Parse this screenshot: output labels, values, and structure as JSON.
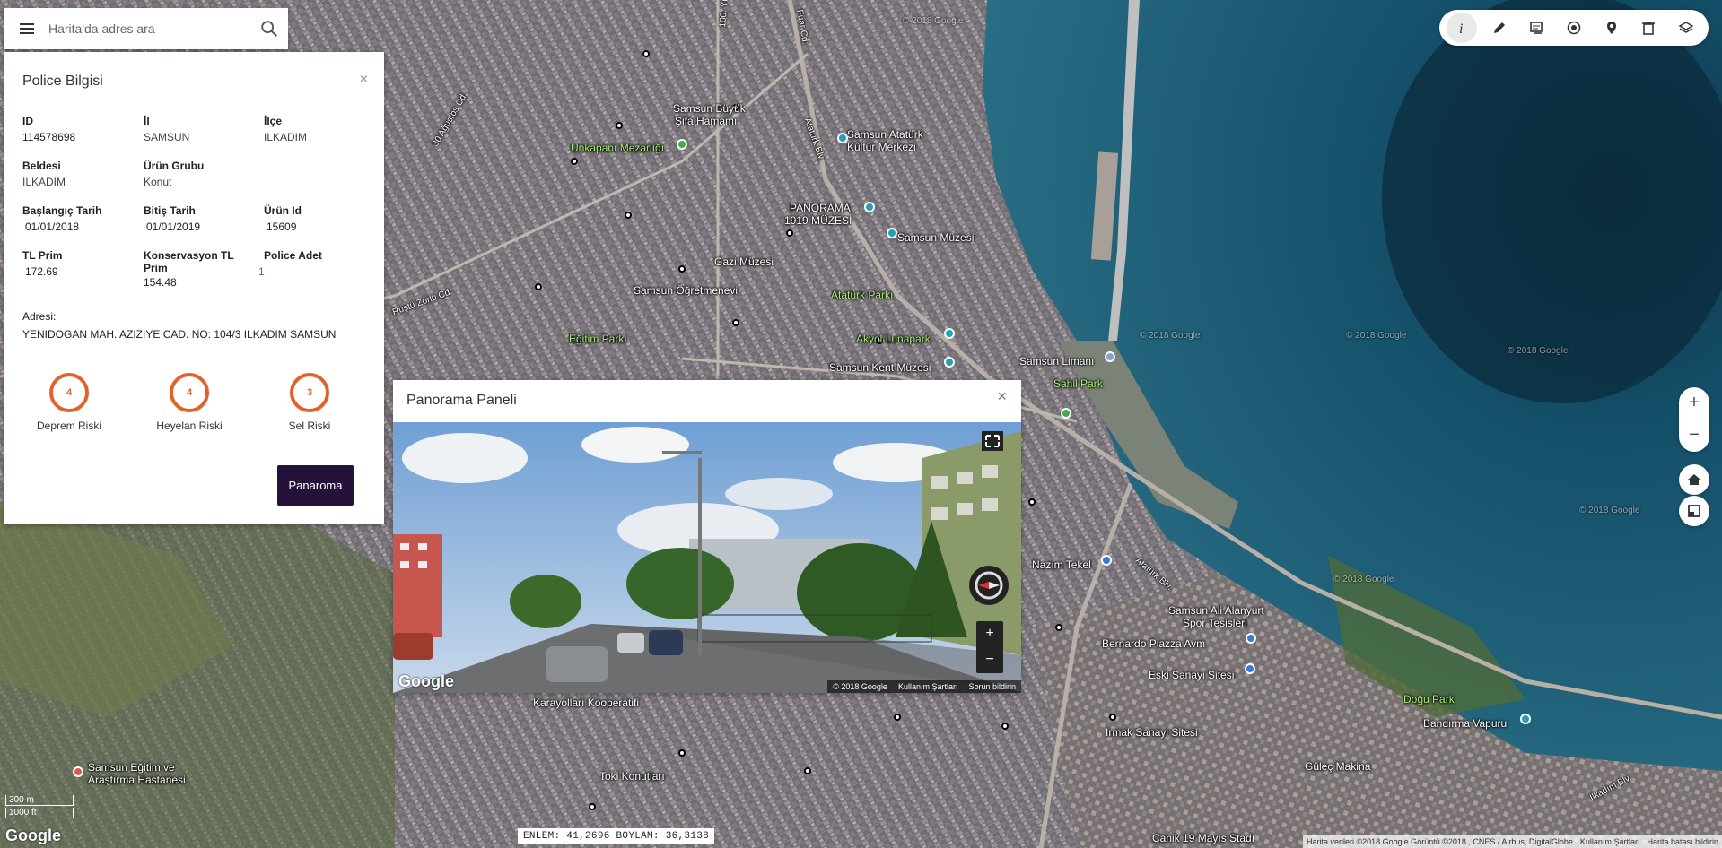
{
  "search": {
    "placeholder": "Harita'da adres ara"
  },
  "police": {
    "title": "Police Bilgisi",
    "close": "×",
    "fields": [
      {
        "label": "ID",
        "value": "114578698"
      },
      {
        "label": "İl",
        "value": "SAMSUN"
      },
      {
        "label": "İlçe",
        "value": "ILKADIM"
      },
      {
        "label": "Beldesi",
        "value": "ILKADIM"
      },
      {
        "label": "Ürün Grubu",
        "value": "Konut"
      },
      {
        "label": "Başlangıç Tarih",
        "value": "01/01/2018"
      },
      {
        "label": "Bitiş Tarih",
        "value": "01/01/2019"
      },
      {
        "label": "Ürün Id",
        "value": "15609"
      },
      {
        "label": "TL Prim",
        "value": "172.69"
      },
      {
        "label": "Konservasyon TL Prim",
        "value": "154.48"
      },
      {
        "label": "Police Adet",
        "value": "1"
      }
    ],
    "address_label": "Adresi:",
    "address": "YENIDOGAN MAH. AZIZIYE CAD. NO: 104/3 ILKADIM SAMSUN",
    "risks": [
      {
        "value": "4",
        "label": "Deprem Riski"
      },
      {
        "value": "4",
        "label": "Heyelan Riski"
      },
      {
        "value": "3",
        "label": "Sel Riski"
      }
    ],
    "panorama_button": "Panaroma",
    "risk_color": "#e2622b",
    "button_color": "#24123b"
  },
  "panorama": {
    "title": "Panorama Paneli",
    "close": "×",
    "zoom_in": "+",
    "zoom_out": "−",
    "google": "Google",
    "footer": [
      "© 2018 Google",
      "Kullanım Şartları",
      "Sorun bildirin"
    ]
  },
  "toolbar": {
    "tools": [
      "info-icon",
      "pencil-icon",
      "layers-card-icon",
      "target-icon",
      "pin-icon",
      "trash-icon",
      "layers-icon"
    ]
  },
  "map_controls": {
    "zoom_in": "+",
    "zoom_out": "−"
  },
  "coords": "ENLEM: 41,2696 BOYLAM: 36,3138",
  "scale": {
    "top": "300 m",
    "bottom": "1000 ft"
  },
  "google_logo": "Google",
  "attribution": [
    "Harita verileri ©2018 Google Görüntü ©2018 , CNES / Airbus, DigitalGlobe",
    "Kullanım Şartları",
    "Harita hatası bildirin"
  ],
  "map_labels": [
    "Samsun Büyük",
    "Şifa Hamamı",
    "Unkapanı Mezarlığı",
    "Samsun Atatürk",
    "Kültür Merkezi",
    "PANORAMA",
    "1919 MÜZESİ",
    "Samsun Müzesi",
    "Gazi Müzesi",
    "Samsun Öğretmenevi",
    "Atatürk Parkı",
    "Eğitim Parkı",
    "Akyol Lunapark",
    "Samsun Kent Müzesi",
    "Samsun Limanı",
    "Sahil Park",
    "Nazım Tekel",
    "Samsun Ali Alanyurt",
    "Spor Tesisleri",
    "Bernardo Piazza Avm",
    "Eski Sanayi Sitesi",
    "Doğu Park",
    "Irmak Sanayi Sitesi",
    "Bandırma Vapuru",
    "Güleç Makina",
    "Karayolları Kooperatifi",
    "Toki Konutları",
    "Samsun Eğitim ve",
    "Araştırma Hastanesi",
    "Canik 19 Mayıs Stadı",
    "© 2018 Google",
    "Fuar Cd.",
    "Atatürk Blv.",
    "100. Yıl Bulvarı",
    "Rüştü Zorlu Cd.",
    "30 Ağustos Cd.",
    "Atatürk Blv.",
    "Ilkadım Blv."
  ]
}
